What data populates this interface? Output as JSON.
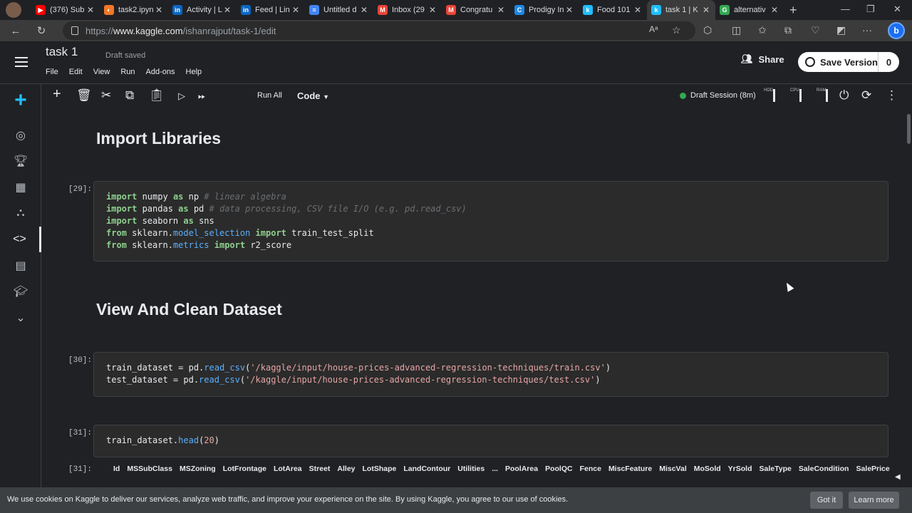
{
  "browser": {
    "tabs": [
      {
        "label": "(376) Sub",
        "icon": "youtube-icon",
        "color": "#ff0000",
        "glyph": "▶"
      },
      {
        "label": "task2.ipyn",
        "icon": "jupyter-icon",
        "color": "#f37726",
        "glyph": "◐"
      },
      {
        "label": "Activity | L",
        "icon": "linkedin-icon",
        "color": "#0a66c2",
        "glyph": "in"
      },
      {
        "label": "Feed | Lin",
        "icon": "linkedin-icon",
        "color": "#0a66c2",
        "glyph": "in"
      },
      {
        "label": "Untitled d",
        "icon": "docs-icon",
        "color": "#4285f4",
        "glyph": "≡"
      },
      {
        "label": "Inbox (29",
        "icon": "gmail-icon",
        "color": "#ea4335",
        "glyph": "M"
      },
      {
        "label": "Congratu",
        "icon": "gmail-icon",
        "color": "#ea4335",
        "glyph": "M"
      },
      {
        "label": "Prodigy In",
        "icon": "prodigy-icon",
        "color": "#1e88e5",
        "glyph": "C"
      },
      {
        "label": "Food 101",
        "icon": "kaggle-icon",
        "color": "#20beff",
        "glyph": "k"
      },
      {
        "label": "task 1 | K",
        "icon": "kaggle-icon",
        "color": "#20beff",
        "glyph": "k"
      },
      {
        "label": "alternativ",
        "icon": "google-icon",
        "color": "#34a853",
        "glyph": "G"
      }
    ],
    "url_prefix": "https://",
    "url_host": "www.kaggle.com",
    "url_path": "/ishanrajput/task-1/edit"
  },
  "header": {
    "title": "task 1",
    "status": "Draft saved",
    "menu": [
      "File",
      "Edit",
      "View",
      "Run",
      "Add-ons",
      "Help"
    ],
    "share_label": "Share",
    "save_label": "Save Version",
    "save_count": "0"
  },
  "toolbar": {
    "run_all": "Run All",
    "cell_type": "Code",
    "session": "Draft Session (8m)",
    "meters": [
      "HDD",
      "CPU",
      "RAM"
    ]
  },
  "notebook": {
    "heading1": "Import Libraries",
    "heading2": "View And Clean Dataset",
    "cell29_num": "[29]:",
    "cell30_num": "[30]:",
    "cell31_num": "[31]:",
    "out31_num": "[31]:",
    "output_columns": [
      "Id",
      "MSSubClass",
      "MSZoning",
      "LotFrontage",
      "LotArea",
      "Street",
      "Alley",
      "LotShape",
      "LandContour",
      "Utilities",
      "...",
      "PoolArea",
      "PoolQC",
      "Fence",
      "MiscFeature",
      "MiscVal",
      "MoSold",
      "YrSold",
      "SaleType",
      "SaleCondition",
      "SalePrice"
    ],
    "code29": [
      [
        [
          "kw",
          "import"
        ],
        [
          "t",
          " numpy "
        ],
        [
          "kw",
          "as"
        ],
        [
          "t",
          " np "
        ],
        [
          "cm",
          "# linear algebra"
        ]
      ],
      [
        [
          "kw",
          "import"
        ],
        [
          "t",
          " pandas "
        ],
        [
          "kw",
          "as"
        ],
        [
          "t",
          " pd "
        ],
        [
          "cm",
          "# data processing, CSV file I/O (e.g. pd.read_csv)"
        ]
      ],
      [
        [
          "kw",
          "import"
        ],
        [
          "t",
          " seaborn "
        ],
        [
          "kw",
          "as"
        ],
        [
          "t",
          " sns"
        ]
      ],
      [
        [
          "kw",
          "from"
        ],
        [
          "t",
          " sklearn."
        ],
        [
          "fn",
          "model_selection"
        ],
        [
          "t",
          " "
        ],
        [
          "kw",
          "import"
        ],
        [
          "t",
          " train_test_split"
        ]
      ],
      [
        [
          "kw",
          "from"
        ],
        [
          "t",
          " sklearn."
        ],
        [
          "fn",
          "metrics"
        ],
        [
          "t",
          " "
        ],
        [
          "kw",
          "import"
        ],
        [
          "t",
          " r2_score"
        ]
      ]
    ],
    "code30": [
      [
        [
          "t",
          "train_dataset = pd."
        ],
        [
          "fn",
          "read_csv"
        ],
        [
          "t",
          "("
        ],
        [
          "st",
          "'/kaggle/input/house-prices-advanced-regression-techniques/train.csv'"
        ],
        [
          "t",
          ")"
        ]
      ],
      [
        [
          "t",
          "test_dataset = pd."
        ],
        [
          "fn",
          "read_csv"
        ],
        [
          "t",
          "("
        ],
        [
          "st",
          "'/kaggle/input/house-prices-advanced-regression-techniques/test.csv'"
        ],
        [
          "t",
          ")"
        ]
      ]
    ],
    "code31": [
      [
        [
          "t",
          "train_dataset."
        ],
        [
          "fn",
          "head"
        ],
        [
          "t",
          "("
        ],
        [
          "st",
          "20"
        ],
        [
          "t",
          ")"
        ]
      ]
    ]
  },
  "cookie": {
    "text": "We use cookies on Kaggle to deliver our services, analyze web traffic, and improve your experience on the site. By using Kaggle, you agree to our use of cookies.",
    "got_it": "Got it",
    "learn_more": "Learn more"
  }
}
